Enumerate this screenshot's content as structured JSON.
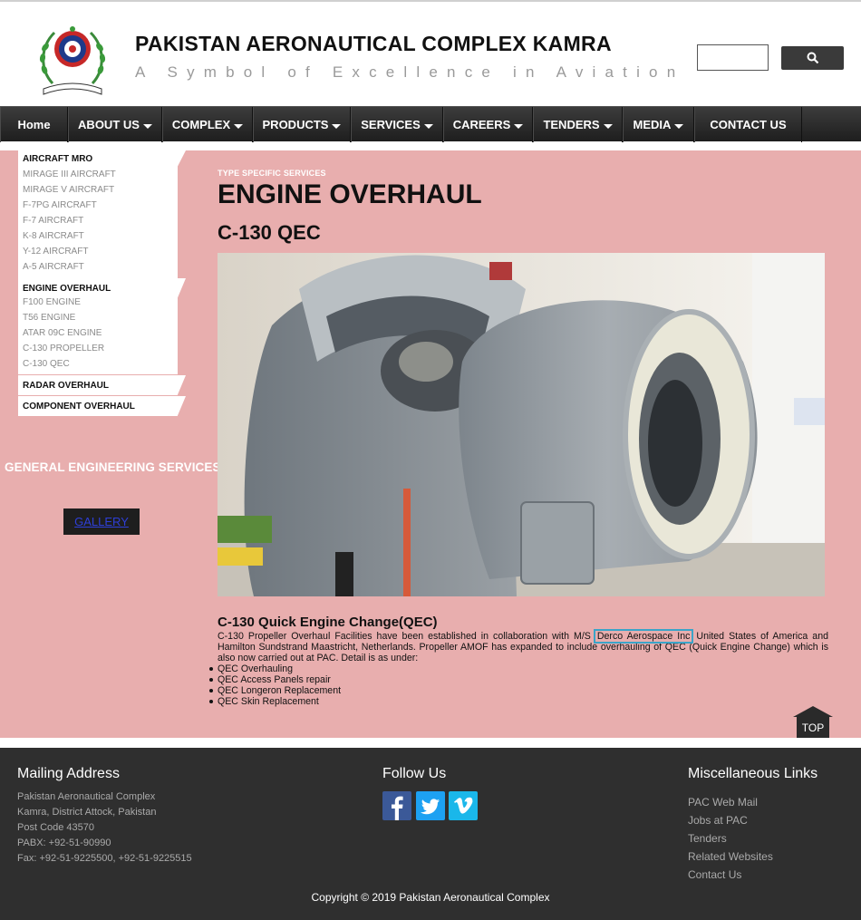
{
  "header": {
    "title": "PAKISTAN AERONAUTICAL COMPLEX KAMRA",
    "tagline": "A Symbol of Excellence in Aviation"
  },
  "nav": [
    {
      "label": "Home",
      "dropdown": false
    },
    {
      "label": "ABOUT US",
      "dropdown": true
    },
    {
      "label": "COMPLEX",
      "dropdown": true
    },
    {
      "label": "PRODUCTS",
      "dropdown": true
    },
    {
      "label": "SERVICES",
      "dropdown": true
    },
    {
      "label": "CAREERS",
      "dropdown": true
    },
    {
      "label": "TENDERS",
      "dropdown": true
    },
    {
      "label": "MEDIA",
      "dropdown": true
    },
    {
      "label": "CONTACT US",
      "dropdown": false
    }
  ],
  "sidebar": {
    "groups": [
      {
        "heading": "AIRCRAFT MRO",
        "items": [
          "MIRAGE III AIRCRAFT",
          "MIRAGE V AIRCRAFT",
          "F-7PG AIRCRAFT",
          "F-7 AIRCRAFT",
          "K-8 AIRCRAFT",
          "Y-12 AIRCRAFT",
          "A-5 AIRCRAFT"
        ]
      },
      {
        "heading": "ENGINE OVERHAUL",
        "items": [
          "F100 ENGINE",
          "T56 ENGINE",
          "ATAR 09C ENGINE",
          "C-130 PROPELLER",
          "C-130 QEC"
        ]
      },
      {
        "heading": "RADAR OVERHAUL",
        "items": []
      },
      {
        "heading": "COMPONENT OVERHAUL",
        "items": []
      }
    ],
    "general_engineering": "GENERAL ENGINEERING SERVICES",
    "gallery": "GALLERY"
  },
  "main": {
    "eyebrow": "TYPE SPECIFIC SERVICES",
    "title": "ENGINE OVERHAUL",
    "subtitle": "C-130 QEC",
    "section_title": "C-130 Quick Engine Change(QEC)",
    "para_before": "C-130 Propeller Overhaul Facilities have been established in collaboration with M/S ",
    "para_highlight": "Derco Aerospace Inc",
    "para_after": " United States of America and Hamilton Sundstrand Maastricht, Netherlands. Propeller AMOF has expanded to include overhauling of QEC (Quick Engine Change) which is also now carried out at PAC. Detail is as under:",
    "bullets": [
      "QEC Overhauling",
      "QEC Access Panels repair",
      "QEC Longeron Replacement",
      "QEC Skin Replacement"
    ],
    "top_label": "TOP"
  },
  "footer": {
    "mailing_heading": "Mailing Address",
    "mailing_lines": [
      "Pakistan Aeronautical Complex",
      "Kamra, District Attock, Pakistan",
      "Post Code 43570",
      "PABX: +92-51-90990",
      "Fax: +92-51-9225500, +92-51-9225515"
    ],
    "follow_heading": "Follow Us",
    "social": [
      "facebook-icon",
      "twitter-icon",
      "vimeo-icon"
    ],
    "misc_heading": "Miscellaneous Links",
    "misc_links": [
      "PAC Web Mail",
      "Jobs at PAC",
      "Tenders",
      "Related Websites",
      "Contact Us"
    ],
    "copyright": "Copyright © 2019 Pakistan Aeronautical Complex"
  },
  "colors": {
    "content_bg": "#e8aeae",
    "nav_bg": "#2b2b2b",
    "footer_bg": "#2f2f2f",
    "highlight_outline": "#3aa4c8"
  }
}
